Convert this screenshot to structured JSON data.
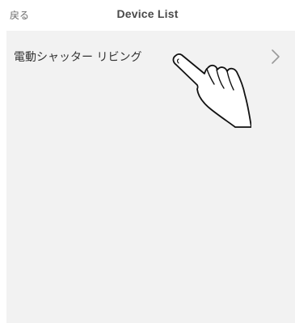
{
  "header": {
    "back_label": "戻る",
    "title": "Device List"
  },
  "devices": [
    {
      "label": "電動シャッター リビング"
    }
  ],
  "icons": {
    "row_chevron": "chevron-right-icon",
    "pointer": "pointing-hand-icon"
  },
  "colors": {
    "background": "#ffffff",
    "list_background": "#f2f2f2",
    "text": "#333333",
    "muted": "#6b6b6b",
    "chevron": "#9a9a9a"
  }
}
